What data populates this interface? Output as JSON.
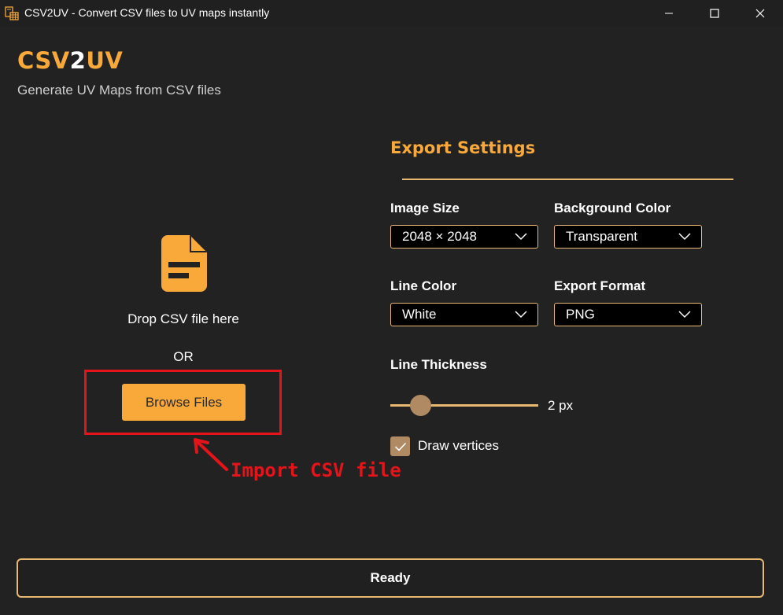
{
  "window": {
    "title": "CSV2UV - Convert CSV files to UV maps instantly",
    "icons": [
      "app-icon",
      "minimize-icon",
      "maximize-icon",
      "close-icon"
    ]
  },
  "header": {
    "brand_part1": "CSV",
    "brand_part2": "2",
    "brand_part3": "UV",
    "subtitle": "Generate UV Maps from CSV files"
  },
  "import": {
    "icon": "file-document-icon",
    "drop_text": "Drop CSV file here",
    "or_text": "OR",
    "browse_label": "Browse Files"
  },
  "annotation": {
    "text": "Import CSV file",
    "color": "#E4141A"
  },
  "export_settings": {
    "title": "Export Settings",
    "image_size": {
      "label": "Image Size",
      "value": "2048 × 2048"
    },
    "background_color": {
      "label": "Background Color",
      "value": "Transparent"
    },
    "line_color": {
      "label": "Line Color",
      "value": "White"
    },
    "export_format": {
      "label": "Export Format",
      "value": "PNG"
    },
    "line_thickness": {
      "label": "Line Thickness",
      "value_text": "2 px",
      "slider_fraction": 0.16
    },
    "draw_vertices": {
      "label": "Draw vertices",
      "checked": true
    }
  },
  "status": {
    "text": "Ready"
  },
  "colors": {
    "accent": "#F9A83A",
    "border": "#E9B972",
    "background": "#222222",
    "control_tan": "#B08A63"
  }
}
